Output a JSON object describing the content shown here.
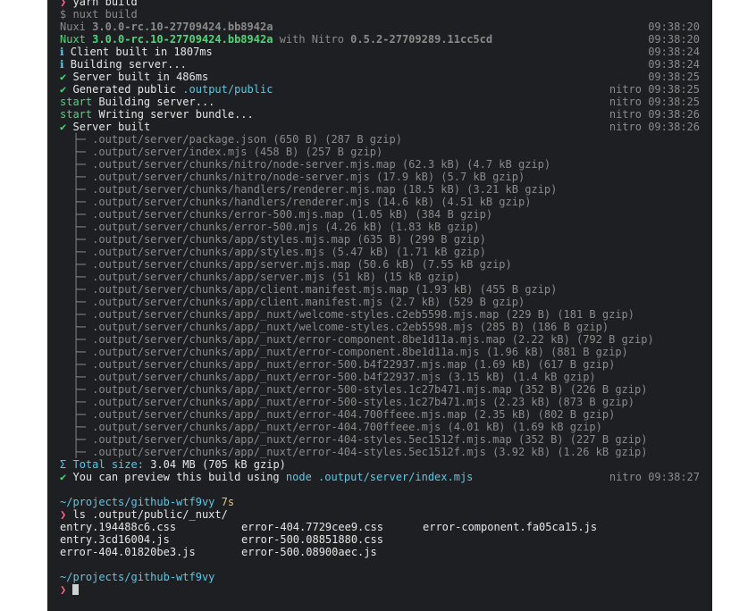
{
  "terminal": {
    "top_command": "yarn build",
    "prompt_symbol": "❯",
    "nuxt_build_cmd": "$ nuxt build",
    "nuxi_line": {
      "label": "Nuxi",
      "version": "3.0.0-rc.10-27709424.bb8942a",
      "time": "09:38:20"
    },
    "nuxt_line": {
      "label": "Nuxt",
      "version": "3.0.0-rc.10-27709424.bb8942a",
      "with": "with Nitro",
      "nitro_version": "0.5.2-27709289.11cc5cd",
      "time": "09:38:20"
    },
    "info_lines": [
      {
        "icon": "ℹ",
        "text": "Client built in 1807ms",
        "time": "09:38:24"
      },
      {
        "icon": "ℹ",
        "text": "Building server...",
        "time": "09:38:24"
      },
      {
        "icon": "✔",
        "text": "Server built in 486ms",
        "time": "09:38:25"
      }
    ],
    "generated": {
      "icon": "✔",
      "text": "Generated public",
      "path": ".output/public",
      "source": "nitro",
      "time": "09:38:25"
    },
    "start_lines": [
      {
        "label": "start",
        "text": "Building server...",
        "source": "nitro",
        "time": "09:38:25"
      },
      {
        "label": "start",
        "text": "Writing server bundle...",
        "source": "nitro",
        "time": "09:38:26"
      }
    ],
    "server_built": {
      "icon": "✔",
      "text": "Server built",
      "source": "nitro",
      "time": "09:38:26"
    },
    "tree_prefix": "├─",
    "files": [
      ".output/server/package.json (650 B) (287 B gzip)",
      ".output/server/index.mjs (458 B) (257 B gzip)",
      ".output/server/chunks/nitro/node-server.mjs.map (62.3 kB) (4.7 kB gzip)",
      ".output/server/chunks/nitro/node-server.mjs (17.9 kB) (5.7 kB gzip)",
      ".output/server/chunks/handlers/renderer.mjs.map (18.5 kB) (3.21 kB gzip)",
      ".output/server/chunks/handlers/renderer.mjs (14.6 kB) (4.51 kB gzip)",
      ".output/server/chunks/error-500.mjs.map (1.05 kB) (384 B gzip)",
      ".output/server/chunks/error-500.mjs (4.26 kB) (1.83 kB gzip)",
      ".output/server/chunks/app/styles.mjs.map (635 B) (299 B gzip)",
      ".output/server/chunks/app/styles.mjs (5.47 kB) (1.71 kB gzip)",
      ".output/server/chunks/app/server.mjs.map (50.6 kB) (7.55 kB gzip)",
      ".output/server/chunks/app/server.mjs (51 kB) (15 kB gzip)",
      ".output/server/chunks/app/client.manifest.mjs.map (1.93 kB) (455 B gzip)",
      ".output/server/chunks/app/client.manifest.mjs (2.7 kB) (529 B gzip)",
      ".output/server/chunks/app/_nuxt/welcome-styles.c2eb5598.mjs.map (229 B) (181 B gzip)",
      ".output/server/chunks/app/_nuxt/welcome-styles.c2eb5598.mjs (285 B) (186 B gzip)",
      ".output/server/chunks/app/_nuxt/error-component.8be1d11a.mjs.map (2.22 kB) (792 B gzip)",
      ".output/server/chunks/app/_nuxt/error-component.8be1d11a.mjs (1.96 kB) (881 B gzip)",
      ".output/server/chunks/app/_nuxt/error-500.b4f22937.mjs.map (1.69 kB) (617 B gzip)",
      ".output/server/chunks/app/_nuxt/error-500.b4f22937.mjs (3.15 kB) (1.4 kB gzip)",
      ".output/server/chunks/app/_nuxt/error-500-styles.1c27b471.mjs.map (352 B) (226 B gzip)",
      ".output/server/chunks/app/_nuxt/error-500-styles.1c27b471.mjs (2.23 kB) (873 B gzip)",
      ".output/server/chunks/app/_nuxt/error-404.700ffeee.mjs.map (2.35 kB) (802 B gzip)",
      ".output/server/chunks/app/_nuxt/error-404.700ffeee.mjs (4.01 kB) (1.69 kB gzip)",
      ".output/server/chunks/app/_nuxt/error-404-styles.5ec1512f.mjs.map (352 B) (227 B gzip)",
      ".output/server/chunks/app/_nuxt/error-404-styles.5ec1512f.mjs (3.92 kB) (1.26 kB gzip)"
    ],
    "total": {
      "icon": "Σ",
      "label": "Total size:",
      "value": "3.04 MB (705 kB gzip)"
    },
    "preview": {
      "icon": "✔",
      "text": "You can preview this build using",
      "command": "node .output/server/index.mjs",
      "source": "nitro",
      "time": "09:38:27"
    },
    "cwd": "~/projects/github-wtf9vy",
    "elapsed": "7s",
    "ls_command": "ls .output/public/_nuxt/",
    "ls_columns": [
      [
        "entry.194488c6.css",
        "entry.3cd16004.js",
        "error-404.01820be3.js"
      ],
      [
        "error-404.7729cee9.css",
        "error-500.08851880.css",
        "error-500.08900aec.js"
      ],
      [
        "error-component.fa05ca15.js"
      ]
    ]
  }
}
